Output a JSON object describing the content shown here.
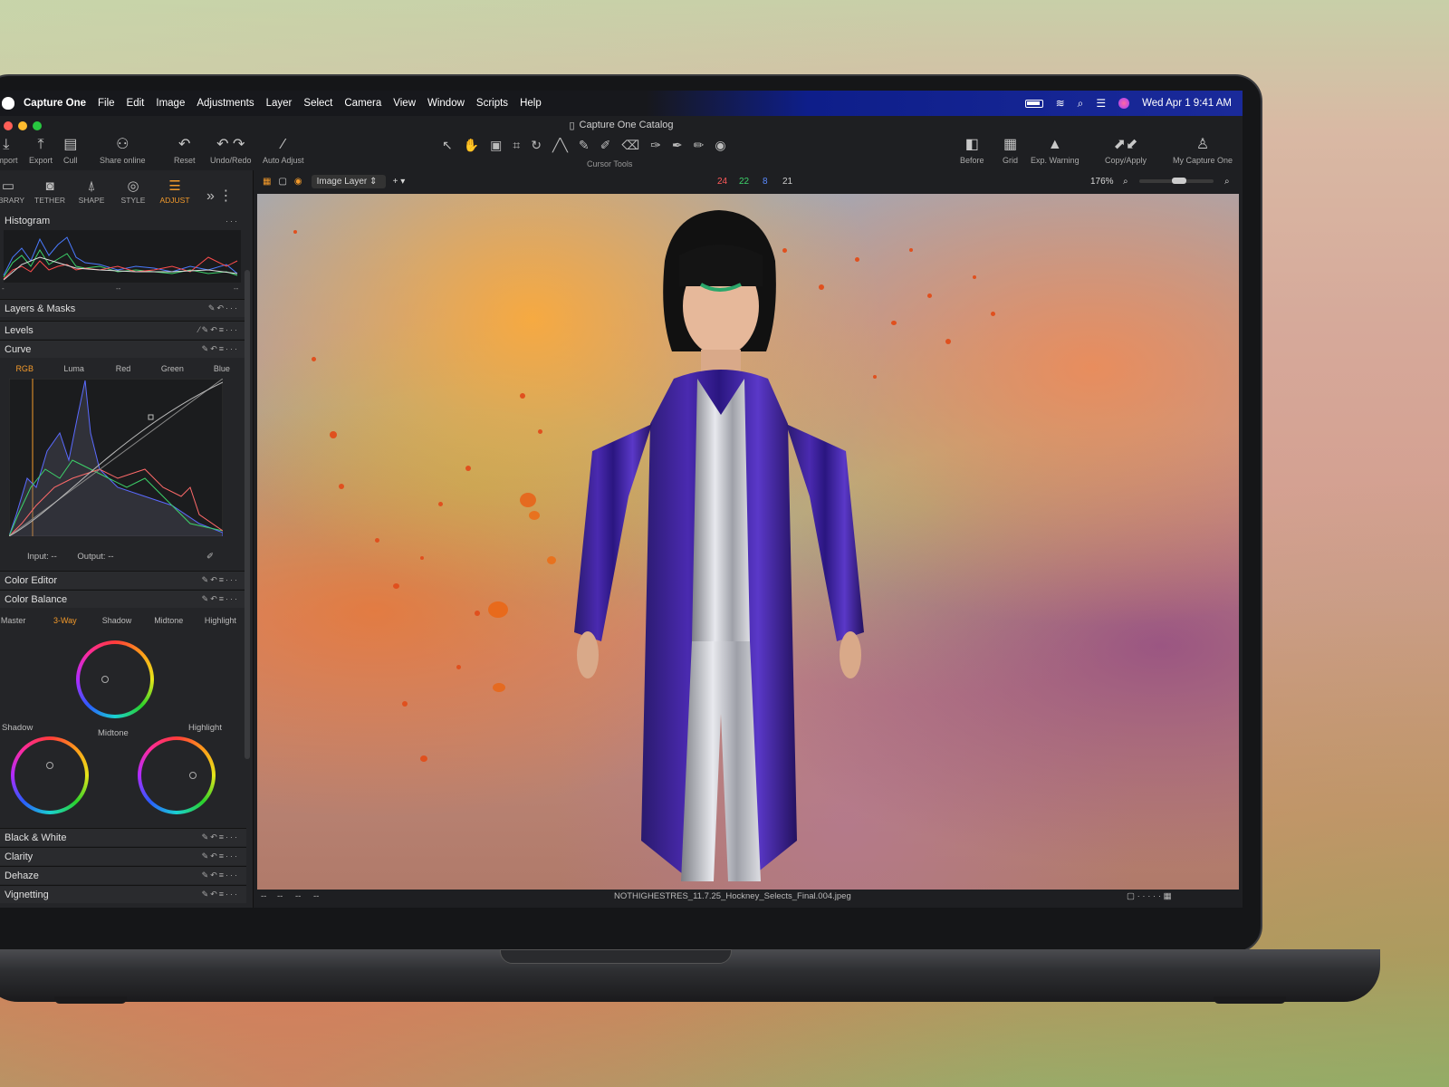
{
  "colors": {
    "accent": "#f39a2b",
    "red_light": "#ff5f57",
    "yellow_light": "#febc2e",
    "green_light": "#28c840"
  },
  "menubar": {
    "app": "Capture One",
    "items": [
      "File",
      "Edit",
      "Image",
      "Adjustments",
      "Layer",
      "Select",
      "Camera",
      "View",
      "Window",
      "Scripts",
      "Help"
    ],
    "datetime": "Wed Apr 1  9:41 AM"
  },
  "window": {
    "title": "Capture One Catalog"
  },
  "toolbar": {
    "import": "Import",
    "export": "Export",
    "cull": "Cull",
    "share": "Share online",
    "reset": "Reset",
    "undo_redo": "Undo/Redo",
    "auto_adjust": "Auto Adjust",
    "cursor_tools": "Cursor Tools",
    "before": "Before",
    "grid": "Grid",
    "exp_warning": "Exp. Warning",
    "copy_apply": "Copy/Apply",
    "my_capture_one": "My Capture One"
  },
  "tool_tabs": [
    "LIBRARY",
    "TETHER",
    "SHAPE",
    "STYLE",
    "ADJUST"
  ],
  "sections": {
    "histogram": "Histogram",
    "layers": "Layers & Masks",
    "levels": "Levels",
    "curve": "Curve",
    "color_editor": "Color Editor",
    "color_balance": "Color Balance",
    "bw": "Black & White",
    "clarity": "Clarity",
    "dehaze": "Dehaze",
    "vignetting": "Vignetting"
  },
  "histo_ticks": {
    "left": "-",
    "mid": "--",
    "right": "--"
  },
  "curve_tabs": [
    "RGB",
    "Luma",
    "Red",
    "Green",
    "Blue"
  ],
  "curve_io": {
    "input": "Input:",
    "input_val": "--",
    "output": "Output:",
    "output_val": "--"
  },
  "balance_tabs": [
    "Master",
    "3-Way",
    "Shadow",
    "Midtone",
    "Highlight"
  ],
  "wheels": {
    "shadow": "Shadow",
    "midtone": "Midtone",
    "highlight": "Highlight"
  },
  "viewer": {
    "layer_select": "Image Layer",
    "counts": {
      "red": "24",
      "green": "22",
      "blue": "8",
      "total": "21"
    },
    "zoom": "176%",
    "filename": "NOTHIGHESTRES_11.7.25_Hockney_Selects_Final.004.jpeg",
    "meta": [
      "--",
      "--",
      "--",
      "--"
    ]
  }
}
